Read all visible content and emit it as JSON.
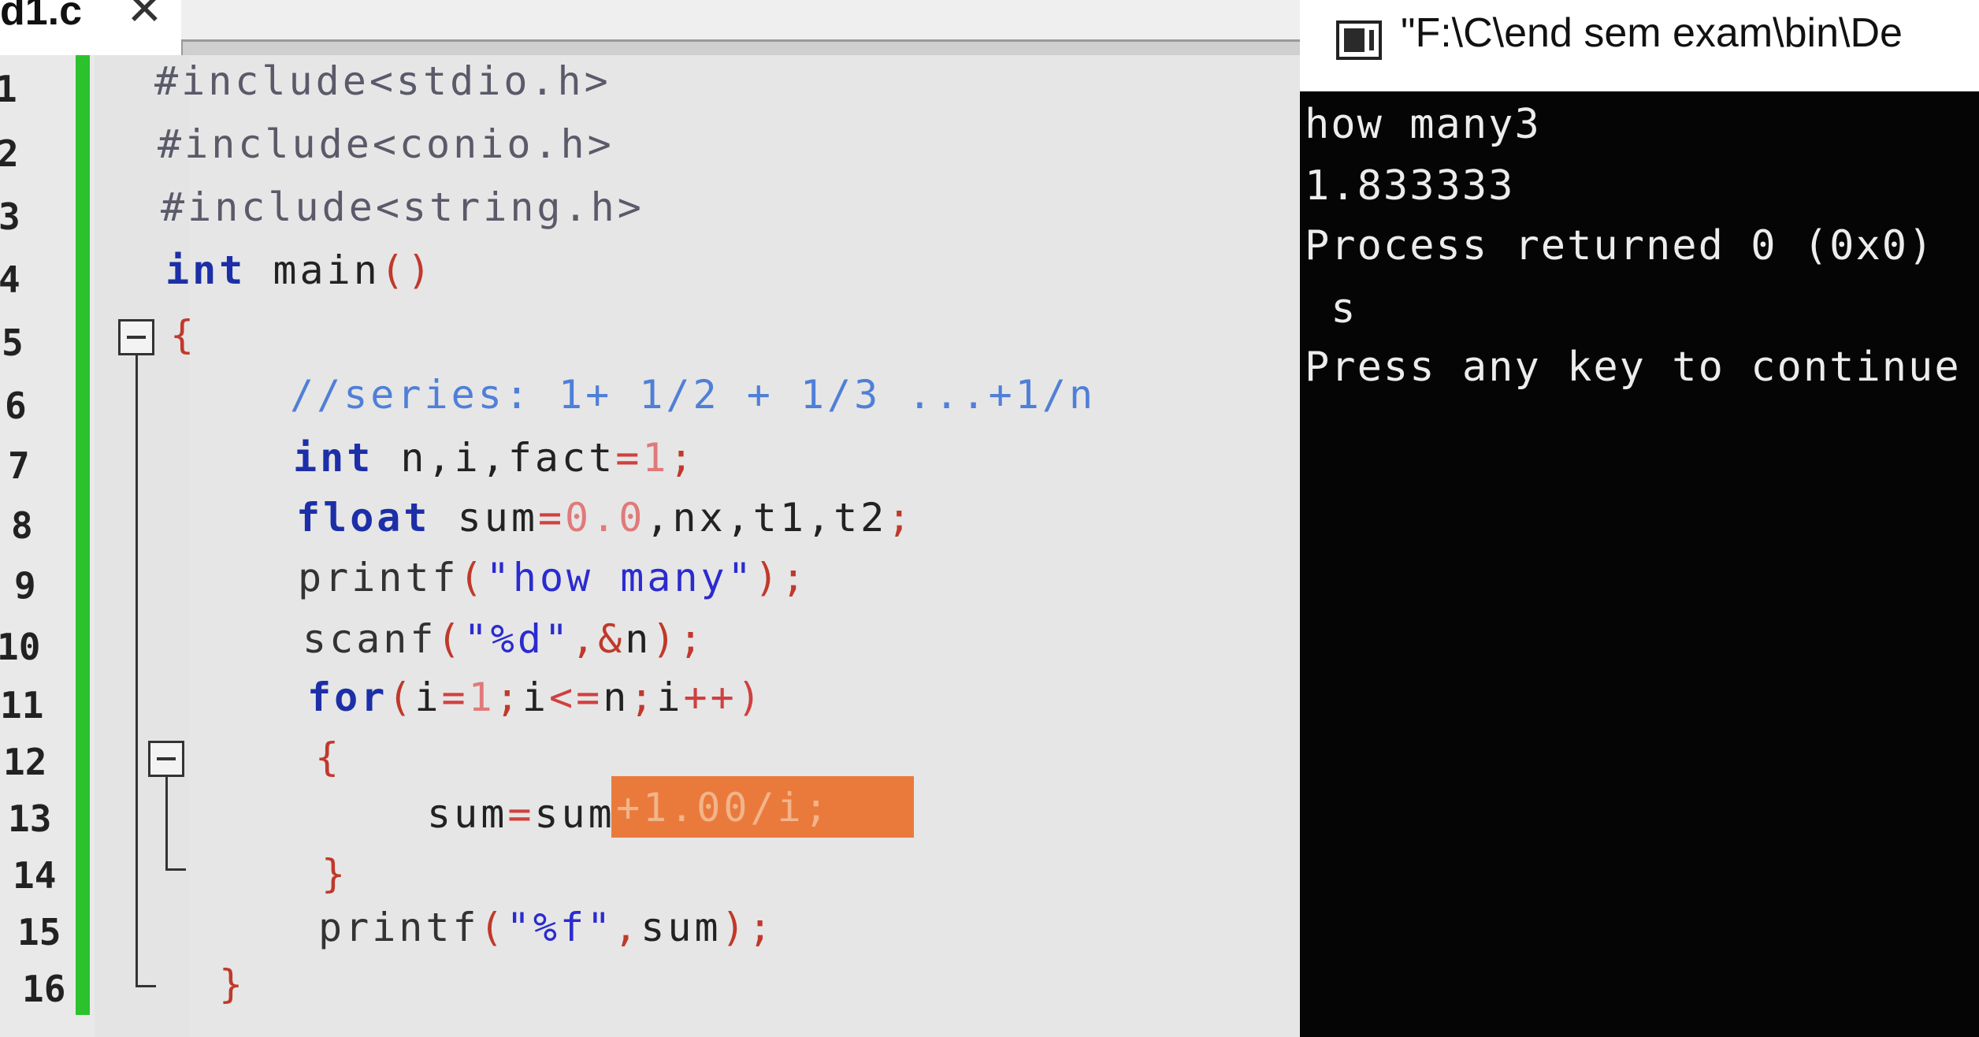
{
  "editor": {
    "tab": {
      "label": "d1.c",
      "close": "✕"
    },
    "line_numbers": [
      "1",
      "2",
      "3",
      "4",
      "5",
      "6",
      "7",
      "8",
      "9",
      "10",
      "11",
      "12",
      "13",
      "14",
      "15",
      "16"
    ],
    "lines": [
      [
        {
          "t": "#include<stdio.h>",
          "c": "pp"
        }
      ],
      [
        {
          "t": "#include<conio.h>",
          "c": "pp"
        }
      ],
      [
        {
          "t": "#include<string.h>",
          "c": "pp"
        }
      ],
      [
        {
          "t": "int",
          "c": "kw"
        },
        {
          "t": " main",
          "c": "id"
        },
        {
          "t": "()",
          "c": "punct"
        }
      ],
      [
        {
          "t": "{",
          "c": "punct"
        }
      ],
      [
        {
          "t": "//series: 1+ 1/2 + 1/3 ...+1/n",
          "c": "cm"
        }
      ],
      [
        {
          "t": "int",
          "c": "kw"
        },
        {
          "t": " n,i,fact",
          "c": "id"
        },
        {
          "t": "=",
          "c": "op"
        },
        {
          "t": "1",
          "c": "num"
        },
        {
          "t": ";",
          "c": "punct"
        }
      ],
      [
        {
          "t": "float",
          "c": "kw"
        },
        {
          "t": " sum",
          "c": "id"
        },
        {
          "t": "=",
          "c": "op"
        },
        {
          "t": "0.0",
          "c": "num"
        },
        {
          "t": ",nx,t1,t2",
          "c": "id"
        },
        {
          "t": ";",
          "c": "punct"
        }
      ],
      [
        {
          "t": "printf",
          "c": "fn"
        },
        {
          "t": "(",
          "c": "punct"
        },
        {
          "t": "\"how many\"",
          "c": "st"
        },
        {
          "t": ");",
          "c": "punct"
        }
      ],
      [
        {
          "t": "scanf",
          "c": "fn"
        },
        {
          "t": "(",
          "c": "punct"
        },
        {
          "t": "\"%d\"",
          "c": "st"
        },
        {
          "t": ",&",
          "c": "punct"
        },
        {
          "t": "n",
          "c": "id"
        },
        {
          "t": ");",
          "c": "punct"
        }
      ],
      [
        {
          "t": "for",
          "c": "kw"
        },
        {
          "t": "(",
          "c": "punct"
        },
        {
          "t": "i",
          "c": "id"
        },
        {
          "t": "=",
          "c": "op"
        },
        {
          "t": "1",
          "c": "num"
        },
        {
          "t": ";",
          "c": "punct"
        },
        {
          "t": "i",
          "c": "id"
        },
        {
          "t": "<=",
          "c": "op"
        },
        {
          "t": "n",
          "c": "id"
        },
        {
          "t": ";",
          "c": "punct"
        },
        {
          "t": "i",
          "c": "id"
        },
        {
          "t": "++)",
          "c": "op"
        }
      ],
      [
        {
          "t": "{",
          "c": "punct"
        }
      ],
      [
        {
          "t": "sum",
          "c": "id"
        },
        {
          "t": "=",
          "c": "op"
        },
        {
          "t": "sum",
          "c": "id"
        }
      ],
      [
        {
          "t": "}",
          "c": "punct"
        }
      ],
      [
        {
          "t": "printf",
          "c": "fn"
        },
        {
          "t": "(",
          "c": "punct"
        },
        {
          "t": "\"%f\"",
          "c": "st"
        },
        {
          "t": ",",
          "c": "punct"
        },
        {
          "t": "sum",
          "c": "id"
        },
        {
          "t": ");",
          "c": "punct"
        }
      ],
      [
        {
          "t": "}",
          "c": "punct"
        }
      ]
    ],
    "highlight_text": "+1.00/i;",
    "colors": {
      "change_bar": "#2bc22e",
      "highlight": "#ea7a3c",
      "keyword": "#1c2fa8"
    }
  },
  "console": {
    "title": "\"F:\\C\\end sem exam\\bin\\De",
    "output": [
      "how many3",
      "1.833333",
      "Process returned 0 (0x0)",
      " s",
      "Press any key to continue"
    ],
    "colors": {
      "background": "#050505",
      "text": "#ececec"
    }
  }
}
